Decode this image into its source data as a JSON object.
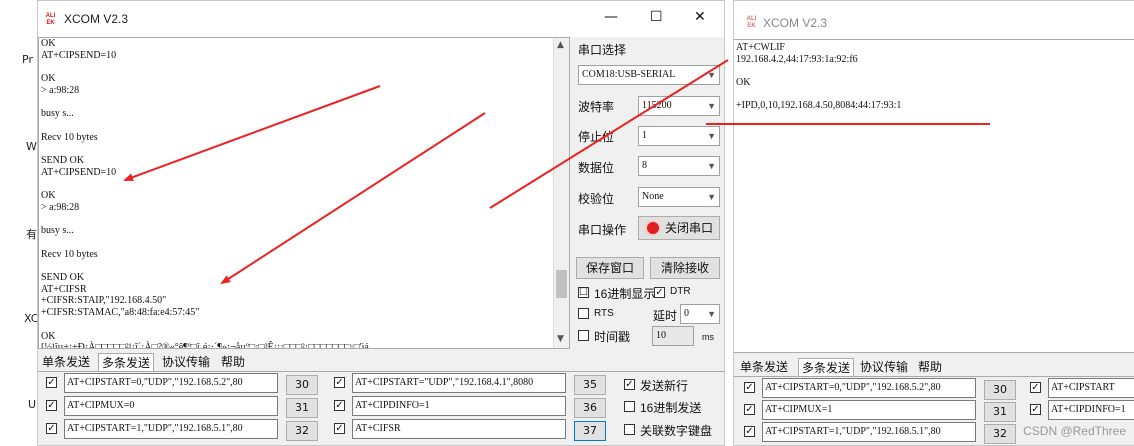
{
  "desktop": {
    "strip_texts": [
      "Pr",
      "W",
      "有",
      "XC",
      "U"
    ]
  },
  "left_window": {
    "logo_text": "ALIENTEK",
    "title": "XCOM V2.3",
    "receive_lines": [
      "OK",
      "AT+CIPSEND=10",
      "",
      "OK",
      "> a:98:28",
      "",
      "busy s...",
      "",
      "Recv 10 bytes",
      "",
      "SEND OK",
      "AT+CIPSEND=10",
      "",
      "OK",
      "> a:98:28",
      "",
      "busy s...",
      "",
      "Recv 10 bytes",
      "",
      "SEND OK",
      "AT+CIFSR",
      "+CIFSR:STAIP,\"192.168.4.50\"",
      "+CIFSR:STAMAC,\"a8:48:fa:e4:57:45\"",
      "",
      "OK",
      "[½¹îµ±¡±Ð¡À□□□□□²¹¡î´¡À□?®«°ê¶º□ï¸é¡·´¶»¡¬åµº□¡□³Ê¡¡¡□□□²¡□□□□□□□¡□'ìá"
    ],
    "serial_select_label": "串口选择",
    "port_value": "COM18:USB-SERIAL",
    "baud_label": "波特率",
    "baud_value": "115200",
    "stopbits_label": "停止位",
    "stopbits_value": "1",
    "databits_label": "数据位",
    "databits_value": "8",
    "parity_label": "校验位",
    "parity_value": "None",
    "port_op_label": "串口操作",
    "close_port_button": "关闭串口",
    "save_window_button": "保存窗口",
    "clear_receive_button": "清除接收",
    "hex_display_label": "16进制显示",
    "hex_display_checked": "☐",
    "dtr_label": "DTR",
    "dtr_checked": "✓",
    "rts_label": "RTS",
    "delay_label": "延时",
    "delay_value": "0",
    "timestamp_label": "时间戳",
    "timestamp_value": "10",
    "timestamp_unit": "ms",
    "tabs": [
      "单条发送",
      "多条发送",
      "协议传输",
      "帮助"
    ],
    "selected_tab": "多条发送",
    "multi_rows_col1": [
      {
        "text": "AT+CIPSTART=0,\"UDP\",\"192.168.5.2\",80",
        "num": "30",
        "checked": "✓"
      },
      {
        "text": "AT+CIPMUX=0",
        "num": "31",
        "checked": "✓"
      },
      {
        "text": "AT+CIPSTART=1,\"UDP\",\"192.168.5.1\",80",
        "num": "32",
        "checked": "✓"
      }
    ],
    "multi_rows_col2": [
      {
        "text": "AT+CIPSTART=\"UDP\",\"192.168.4.1\",8080",
        "num": "35",
        "checked": "✓"
      },
      {
        "text": "AT+CIPDINFO=1",
        "num": "36",
        "checked": "✓"
      },
      {
        "text": "AT+CIFSR",
        "num": "37",
        "checked": "✓"
      }
    ],
    "send_newline_label": "发送新行",
    "send_newline_checked": "✓",
    "hex_send_label": "16进制发送",
    "linkage_label": "关联数字键盘"
  },
  "right_window": {
    "logo_text": "ALIENTEK",
    "title": "XCOM V2.3",
    "receive_lines": [
      "AT+CWLIF",
      "192.168.4.2,44:17:93:1a:92:f6",
      "",
      "OK",
      "",
      "+IPD,0,10,192.168.4.50,8084:44:17:93:1"
    ],
    "tabs": [
      "单条发送",
      "多条发送",
      "协议传输",
      "帮助"
    ],
    "selected_tab": "多条发送",
    "multi_rows_col1": [
      {
        "text": "AT+CIPSTART=0,\"UDP\",\"192.168.5.2\",80",
        "num": "30",
        "checked": "✓"
      },
      {
        "text": "AT+CIPMUX=1",
        "num": "31",
        "checked": "✓"
      },
      {
        "text": "AT+CIPSTART=1,\"UDP\",\"192.168.5.1\",80",
        "num": "32",
        "checked": "✓"
      }
    ],
    "multi_rows_col2": [
      {
        "text": "AT+CIPSTART",
        "checked": "✓"
      },
      {
        "text": "AT+CIPDINFO=1",
        "checked": "✓"
      }
    ]
  },
  "watermark": "CSDN @RedThree",
  "colors": {
    "annotation_arrow": "#ee2020",
    "close_port_dot": "#e02020"
  }
}
